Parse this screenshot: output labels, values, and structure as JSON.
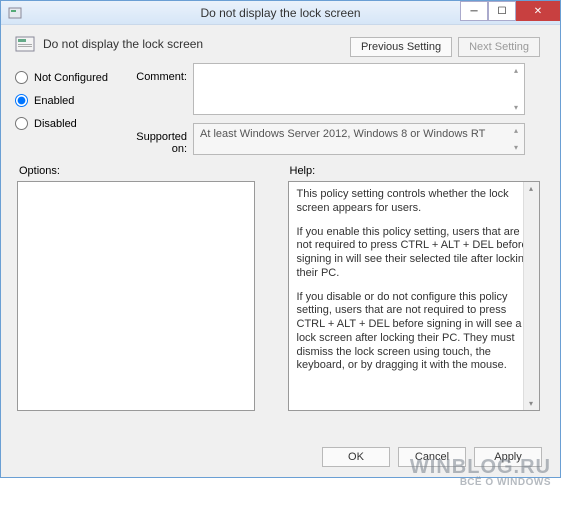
{
  "window": {
    "title": "Do not display the lock screen"
  },
  "header": {
    "title": "Do not display the lock screen"
  },
  "nav": {
    "prev": "Previous Setting",
    "next": "Next Setting"
  },
  "state": {
    "not_configured": "Not Configured",
    "enabled": "Enabled",
    "disabled": "Disabled",
    "selected": "enabled"
  },
  "labels": {
    "comment": "Comment:",
    "supported": "Supported on:",
    "options": "Options:",
    "help": "Help:"
  },
  "supported_text": "At least Windows Server 2012, Windows 8 or Windows RT",
  "help": {
    "p1": "This policy setting controls whether the lock screen appears for users.",
    "p2": "If you enable this policy setting, users that are not required to press CTRL + ALT + DEL before signing in will see their selected tile after  locking their PC.",
    "p3": "If you disable or do not configure this policy setting, users that are not required to press CTRL + ALT + DEL before signing in will see a lock screen after locking their PC. They must dismiss the lock screen using touch, the keyboard, or by dragging it with the mouse."
  },
  "footer": {
    "ok": "OK",
    "cancel": "Cancel",
    "apply": "Apply"
  },
  "watermark": {
    "main": "WINBLOG.RU",
    "sub": "ВСЁ О WINDOWS"
  }
}
